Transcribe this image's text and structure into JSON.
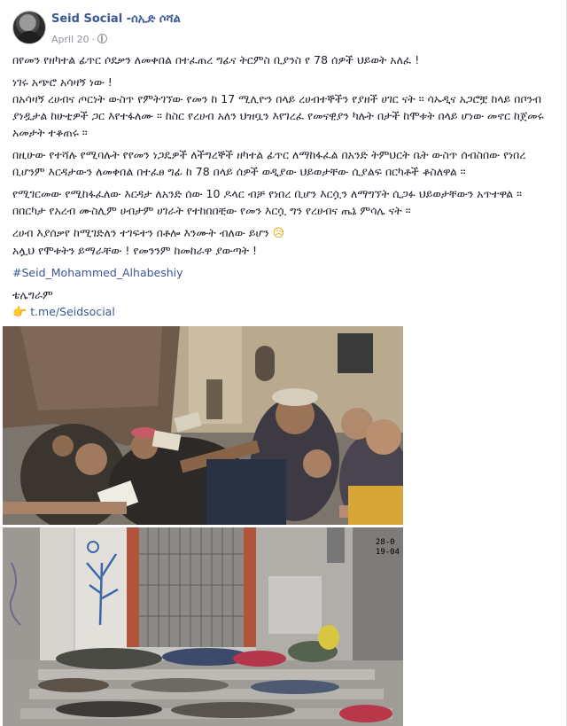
{
  "post": {
    "page_name": "Seid Social -ሰኢድ ሶሻል",
    "date": "April 20",
    "privacy_icon": "globe-icon",
    "paragraphs": [
      "በየመን የዘካተል ፊጥር ሶደቃን ለመቀበል በተፈጠረ ግፊና ትርምስ ቢያንስ የ 78 ሰዎች ህይወት አለፈ !",
      "ነገሩ አጭሮ አሳዛኝ ነው !",
      "በአሳዛኝ ረሀብና ጦርነት ውስጥ የምትገኘው የመን ከ 17 ሚሊዮን በላይ ረሀብተኞችን የያዘች ሀገር ናት ። ሳኡዲና አጋሮቿ ከላይ በቦንብ ያነዷታል ከሁቲዎች ጋር እየተፋለሙ ። ከስር የረሀብ አለን ህዝቧን እየገረፈ የመናዊያን ካሉት በታች ከሞቱት በላይ ሆነው መኖር ከጀመሩ አመታት ተቆጠሩ ።",
      "በዚሁው የተሻሉ የሚባሉት የየመን ነጋዴዎች ለችግረኞች ዘካተል ፊጥር ለማከፋፈል በአንድ ትምህርት ቤት ውስጥ ሰብስበው የነበረ ቢሆንም እርዳታውን ለመቀበል በተፈፀ ግፊ ከ 78 በላይ ሰዎች ወዲያው ህይወታቸው ሲያልፍ በርካቶች ቆስለዋል ።",
      "የሚገርመው የሚከፋፈለው እርዳታ ለአንድ ሰው 10 ዶላር ብቻ የነበረ ቢሆን እርሷን ለማግኘት ሲጋፉ ህይወታቸውን አጥተዋል ። በበርካታ የአረብ ሙስሊም ሀብታም ሀገራት የተከበበቺው የመን እርሷ ግን የረሀብና ጤኔ ምሳሌ ናት ።",
      "ረሀብ እያሰቃየ ከሚገድለን ተገፍተን በቶሎ እንሙት ብለው ይሆን",
      "አሏህ የሞቱትን ይማራቸው ! የመንንም ከመከራዋ ያውጣት !"
    ],
    "sad_emoji": "😥",
    "hashtag": "#Seid_Mohammed_Alhabeshiy",
    "telegram_label": "ቴሌግራም",
    "pointer_emoji": "👉",
    "telegram_link": "t.me/Seidsocial",
    "photo2_timestamp": [
      "28-0",
      "19-04"
    ]
  },
  "colors": {
    "name_blue": "#385898",
    "meta_gray": "#90949c",
    "text": "#1d2129"
  }
}
